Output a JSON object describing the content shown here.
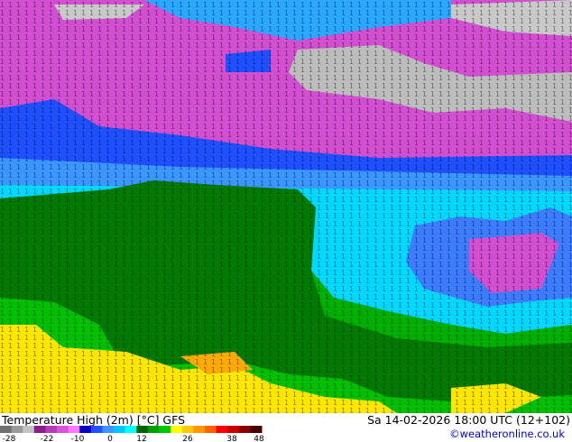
{
  "map": {
    "title": "Temperature High (2m) [°C] GFS",
    "valid_time": "Sa 14-02-2026 18:00 UTC (12+102)",
    "credit": "©weatheronline.co.uk",
    "scale": {
      "ticks": [
        "-28",
        "-22",
        "-10",
        "0",
        "12",
        "26",
        "38",
        "48"
      ],
      "colors": [
        "#707070",
        "#9a9a9a",
        "#c3c3c3",
        "#8b1c8b",
        "#b43cb4",
        "#dc50dc",
        "#ff78ff",
        "#0000c8",
        "#1e50ff",
        "#3c96ff",
        "#00c8ff",
        "#00ffff",
        "#006400",
        "#00a000",
        "#00c800",
        "#ffff00",
        "#ffc800",
        "#ff9600",
        "#ff6400",
        "#ff0000",
        "#c80000",
        "#8b0000",
        "#4a0000"
      ]
    }
  }
}
